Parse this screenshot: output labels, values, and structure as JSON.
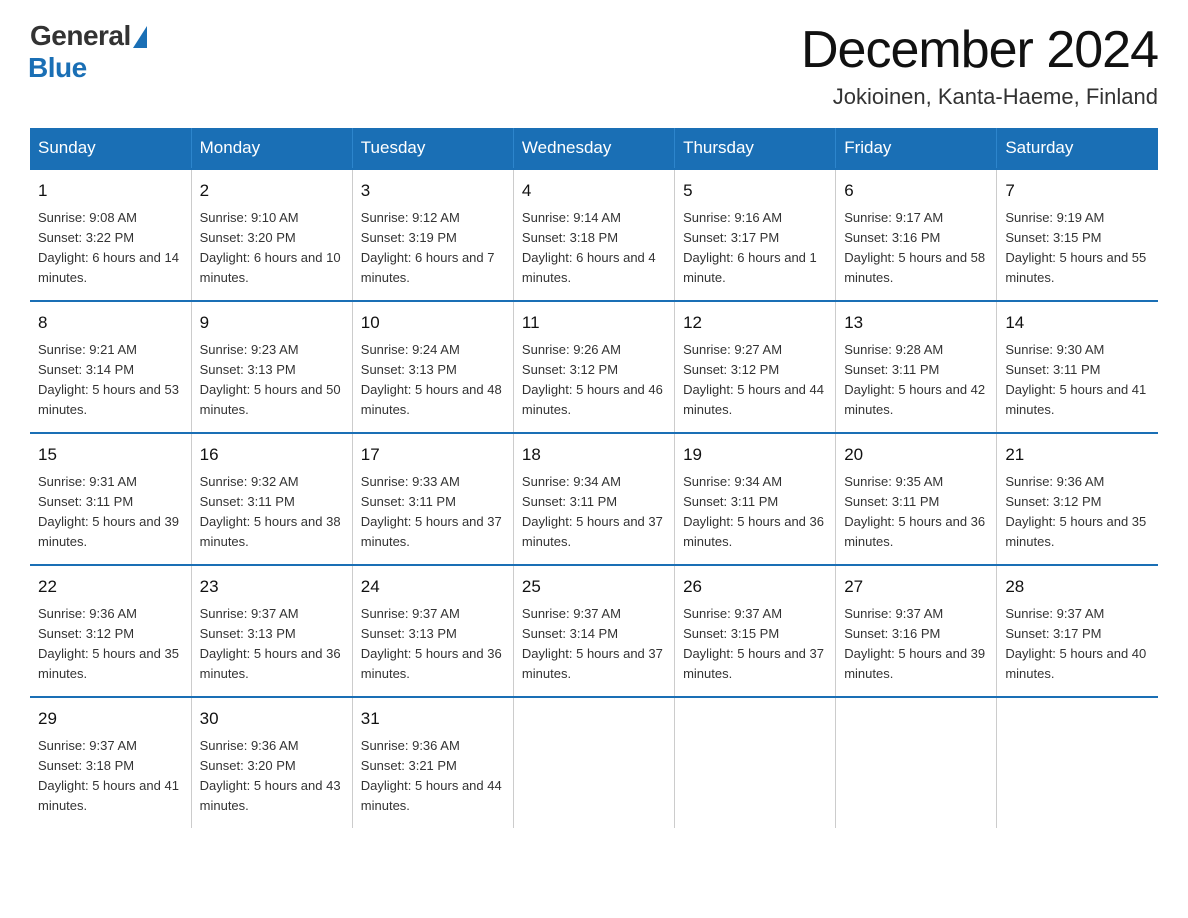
{
  "header": {
    "logo_general": "General",
    "logo_blue": "Blue",
    "month_title": "December 2024",
    "location": "Jokioinen, Kanta-Haeme, Finland"
  },
  "columns": [
    "Sunday",
    "Monday",
    "Tuesday",
    "Wednesday",
    "Thursday",
    "Friday",
    "Saturday"
  ],
  "weeks": [
    [
      {
        "day": "1",
        "sunrise": "9:08 AM",
        "sunset": "3:22 PM",
        "daylight": "6 hours and 14 minutes."
      },
      {
        "day": "2",
        "sunrise": "9:10 AM",
        "sunset": "3:20 PM",
        "daylight": "6 hours and 10 minutes."
      },
      {
        "day": "3",
        "sunrise": "9:12 AM",
        "sunset": "3:19 PM",
        "daylight": "6 hours and 7 minutes."
      },
      {
        "day": "4",
        "sunrise": "9:14 AM",
        "sunset": "3:18 PM",
        "daylight": "6 hours and 4 minutes."
      },
      {
        "day": "5",
        "sunrise": "9:16 AM",
        "sunset": "3:17 PM",
        "daylight": "6 hours and 1 minute."
      },
      {
        "day": "6",
        "sunrise": "9:17 AM",
        "sunset": "3:16 PM",
        "daylight": "5 hours and 58 minutes."
      },
      {
        "day": "7",
        "sunrise": "9:19 AM",
        "sunset": "3:15 PM",
        "daylight": "5 hours and 55 minutes."
      }
    ],
    [
      {
        "day": "8",
        "sunrise": "9:21 AM",
        "sunset": "3:14 PM",
        "daylight": "5 hours and 53 minutes."
      },
      {
        "day": "9",
        "sunrise": "9:23 AM",
        "sunset": "3:13 PM",
        "daylight": "5 hours and 50 minutes."
      },
      {
        "day": "10",
        "sunrise": "9:24 AM",
        "sunset": "3:13 PM",
        "daylight": "5 hours and 48 minutes."
      },
      {
        "day": "11",
        "sunrise": "9:26 AM",
        "sunset": "3:12 PM",
        "daylight": "5 hours and 46 minutes."
      },
      {
        "day": "12",
        "sunrise": "9:27 AM",
        "sunset": "3:12 PM",
        "daylight": "5 hours and 44 minutes."
      },
      {
        "day": "13",
        "sunrise": "9:28 AM",
        "sunset": "3:11 PM",
        "daylight": "5 hours and 42 minutes."
      },
      {
        "day": "14",
        "sunrise": "9:30 AM",
        "sunset": "3:11 PM",
        "daylight": "5 hours and 41 minutes."
      }
    ],
    [
      {
        "day": "15",
        "sunrise": "9:31 AM",
        "sunset": "3:11 PM",
        "daylight": "5 hours and 39 minutes."
      },
      {
        "day": "16",
        "sunrise": "9:32 AM",
        "sunset": "3:11 PM",
        "daylight": "5 hours and 38 minutes."
      },
      {
        "day": "17",
        "sunrise": "9:33 AM",
        "sunset": "3:11 PM",
        "daylight": "5 hours and 37 minutes."
      },
      {
        "day": "18",
        "sunrise": "9:34 AM",
        "sunset": "3:11 PM",
        "daylight": "5 hours and 37 minutes."
      },
      {
        "day": "19",
        "sunrise": "9:34 AM",
        "sunset": "3:11 PM",
        "daylight": "5 hours and 36 minutes."
      },
      {
        "day": "20",
        "sunrise": "9:35 AM",
        "sunset": "3:11 PM",
        "daylight": "5 hours and 36 minutes."
      },
      {
        "day": "21",
        "sunrise": "9:36 AM",
        "sunset": "3:12 PM",
        "daylight": "5 hours and 35 minutes."
      }
    ],
    [
      {
        "day": "22",
        "sunrise": "9:36 AM",
        "sunset": "3:12 PM",
        "daylight": "5 hours and 35 minutes."
      },
      {
        "day": "23",
        "sunrise": "9:37 AM",
        "sunset": "3:13 PM",
        "daylight": "5 hours and 36 minutes."
      },
      {
        "day": "24",
        "sunrise": "9:37 AM",
        "sunset": "3:13 PM",
        "daylight": "5 hours and 36 minutes."
      },
      {
        "day": "25",
        "sunrise": "9:37 AM",
        "sunset": "3:14 PM",
        "daylight": "5 hours and 37 minutes."
      },
      {
        "day": "26",
        "sunrise": "9:37 AM",
        "sunset": "3:15 PM",
        "daylight": "5 hours and 37 minutes."
      },
      {
        "day": "27",
        "sunrise": "9:37 AM",
        "sunset": "3:16 PM",
        "daylight": "5 hours and 39 minutes."
      },
      {
        "day": "28",
        "sunrise": "9:37 AM",
        "sunset": "3:17 PM",
        "daylight": "5 hours and 40 minutes."
      }
    ],
    [
      {
        "day": "29",
        "sunrise": "9:37 AM",
        "sunset": "3:18 PM",
        "daylight": "5 hours and 41 minutes."
      },
      {
        "day": "30",
        "sunrise": "9:36 AM",
        "sunset": "3:20 PM",
        "daylight": "5 hours and 43 minutes."
      },
      {
        "day": "31",
        "sunrise": "9:36 AM",
        "sunset": "3:21 PM",
        "daylight": "5 hours and 44 minutes."
      },
      null,
      null,
      null,
      null
    ]
  ]
}
